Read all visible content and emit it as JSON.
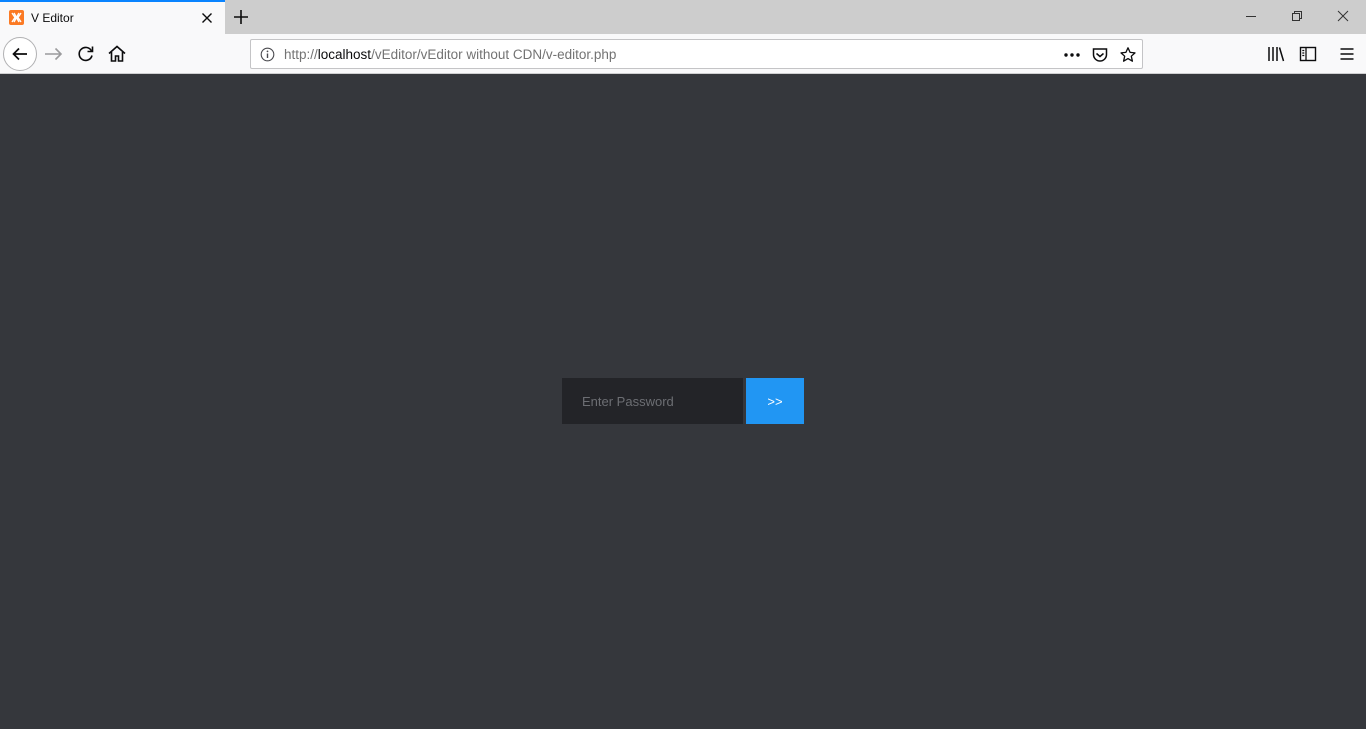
{
  "browser": {
    "tab_title": "V Editor",
    "url_scheme": "http://",
    "url_host": "localhost",
    "url_path": "/vEditor/vEditor without CDN/v-editor.php",
    "accent_color": "#0a84ff"
  },
  "icons": {
    "favicon": "xampp-logo-icon",
    "tab_close": "close-icon",
    "new_tab": "plus-icon",
    "back": "back-arrow-icon",
    "forward": "forward-arrow-icon",
    "reload": "reload-icon",
    "home": "home-icon",
    "site_info": "info-icon",
    "page_actions": "more-icon",
    "pocket": "pocket-icon",
    "bookmark": "star-icon",
    "library": "library-icon",
    "sidebar": "sidebar-icon",
    "menu": "hamburger-menu-icon"
  },
  "login": {
    "password_placeholder": "Enter Password",
    "password_value": "",
    "submit_label": ">>",
    "button_color": "#2196f3",
    "input_bg": "#232428",
    "page_bg": "#35373c"
  }
}
